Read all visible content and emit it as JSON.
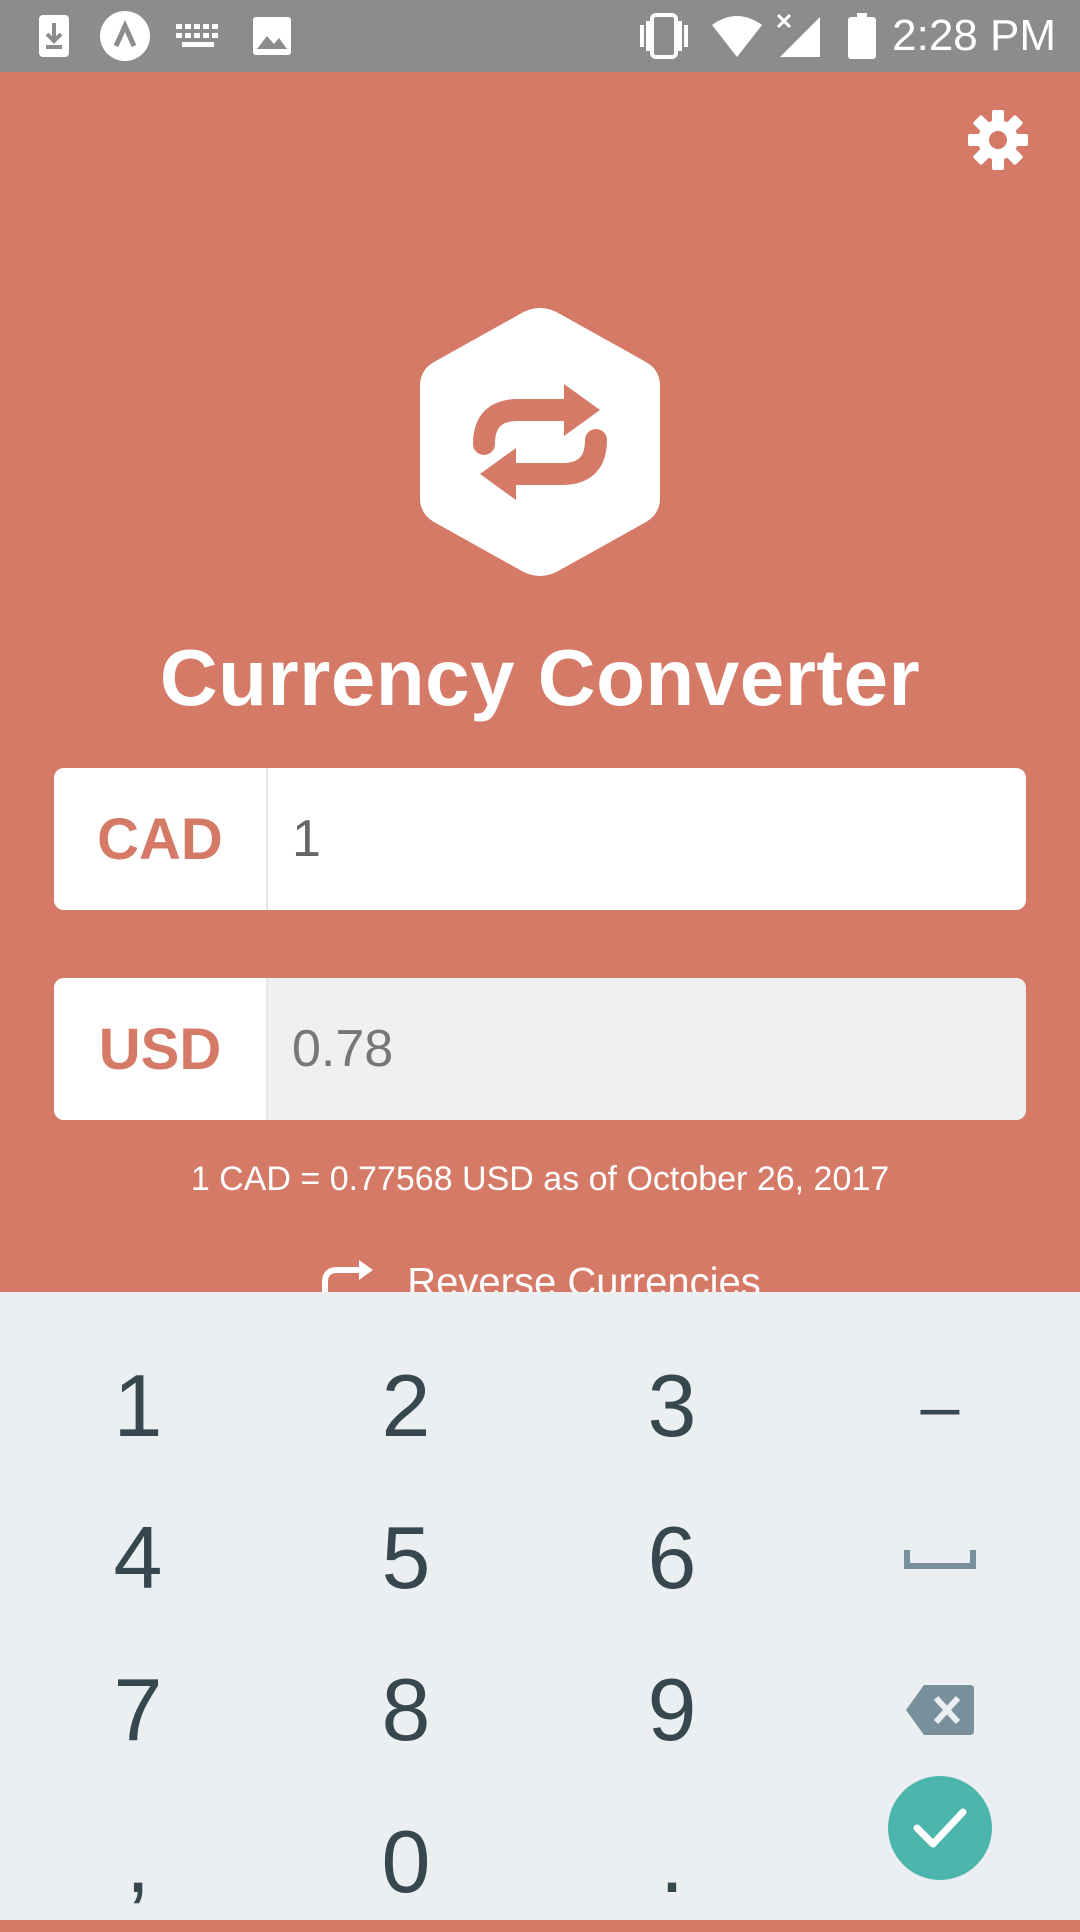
{
  "status_bar": {
    "time": "2:28 PM",
    "left_icons": [
      "download-icon",
      "app-notification-icon",
      "keyboard-icon",
      "image-icon"
    ],
    "right_icons": [
      "vibrate-icon",
      "wifi-icon",
      "signal-icon",
      "battery-icon"
    ]
  },
  "app": {
    "title": "Currency Converter",
    "base": {
      "currency": "CAD",
      "amount": "1"
    },
    "quote": {
      "currency": "USD",
      "amount": "0.78"
    },
    "rate_text": "1 CAD = 0.77568 USD as of October 26, 2017",
    "reverse_label": "Reverse Currencies",
    "accent_color": "#d57a67"
  },
  "keyboard": {
    "keys": [
      "1",
      "2",
      "3",
      "–",
      "4",
      "5",
      "6",
      "␣",
      "7",
      "8",
      "9",
      "⌫",
      ",",
      "0",
      "."
    ],
    "done_color": "#4db6ac"
  }
}
